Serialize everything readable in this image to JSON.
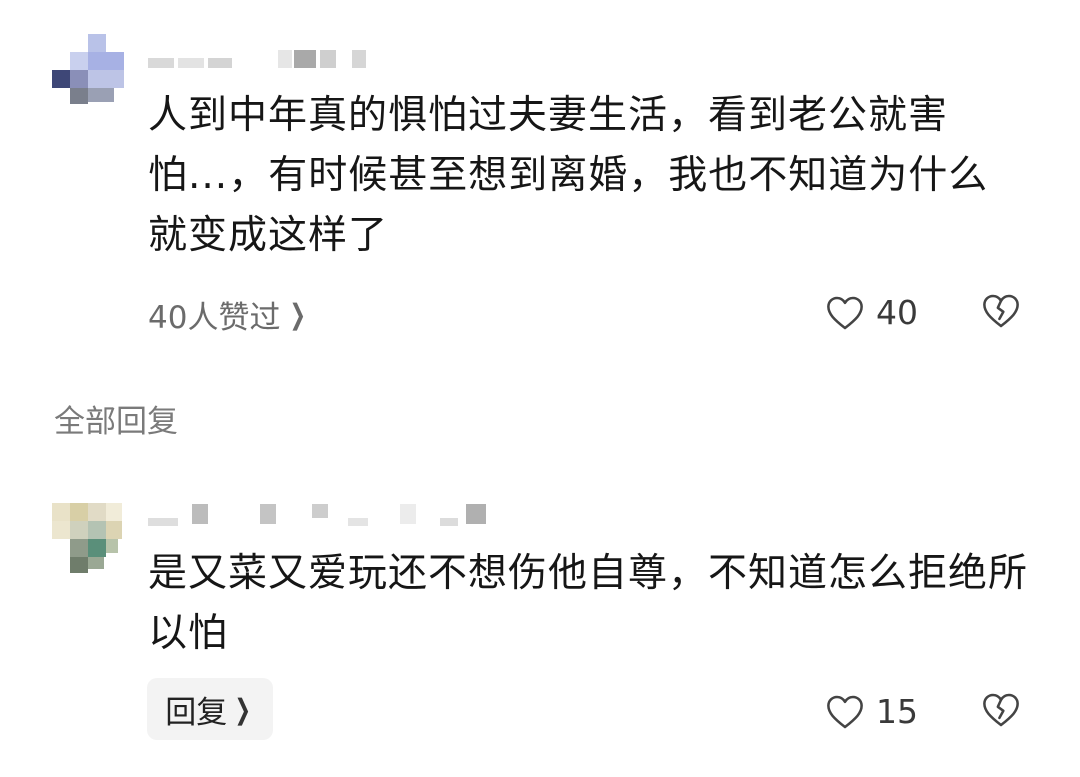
{
  "comment": {
    "text": "人到中年真的惧怕过夫妻生活，看到老公就害怕...，有时候甚至想到离婚，我也不知道为什么就变成这样了",
    "likers_label": "40人赞过",
    "like_count": "40",
    "icons": {
      "like": "heart-outline-icon",
      "dislike": "broken-heart-icon",
      "more": "chevron-right-icon"
    }
  },
  "section_title": "全部回复",
  "reply": {
    "text": "是又菜又爱玩还不想伤他自尊，不知道怎么拒绝所以怕",
    "reply_button_label": "回复",
    "like_count": "15"
  }
}
